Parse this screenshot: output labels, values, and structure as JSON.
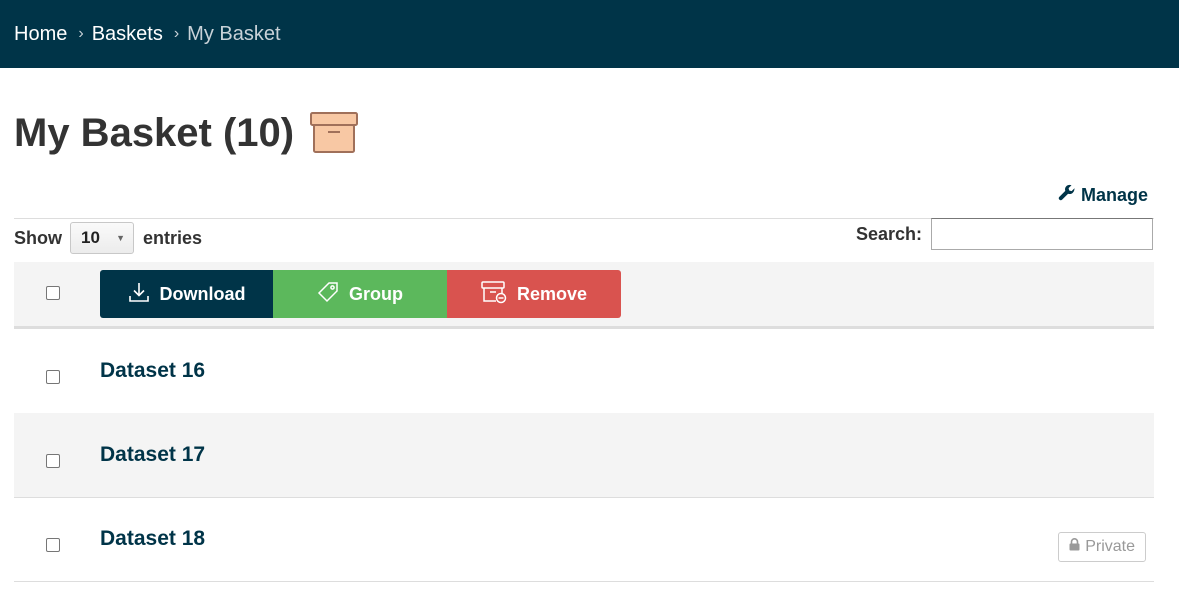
{
  "breadcrumb": {
    "items": [
      {
        "label": "Home"
      },
      {
        "label": "Baskets"
      },
      {
        "label": "My Basket"
      }
    ],
    "separator": "›"
  },
  "page": {
    "title": "My Basket (10)",
    "icon": "archive-box-icon"
  },
  "manage": {
    "label": "Manage",
    "icon": "wrench-icon"
  },
  "table_controls": {
    "show_label": "Show",
    "page_size": "10",
    "entries_label": "entries",
    "search_label": "Search:",
    "search_value": ""
  },
  "actions": {
    "download": {
      "label": "Download",
      "icon": "download-icon",
      "color": "#003448"
    },
    "group": {
      "label": "Group",
      "icon": "tag-icon",
      "color": "#5cb85c"
    },
    "remove": {
      "label": "Remove",
      "icon": "remove-box-icon",
      "color": "#d9534f"
    }
  },
  "rows": [
    {
      "title": "Dataset 16",
      "badge": ""
    },
    {
      "title": "Dataset 17",
      "badge": ""
    },
    {
      "title": "Dataset 18",
      "badge": "Private",
      "badge_icon": "lock-icon"
    }
  ],
  "colors": {
    "brand": "#003448",
    "basket_icon": "#f8c8a4"
  }
}
